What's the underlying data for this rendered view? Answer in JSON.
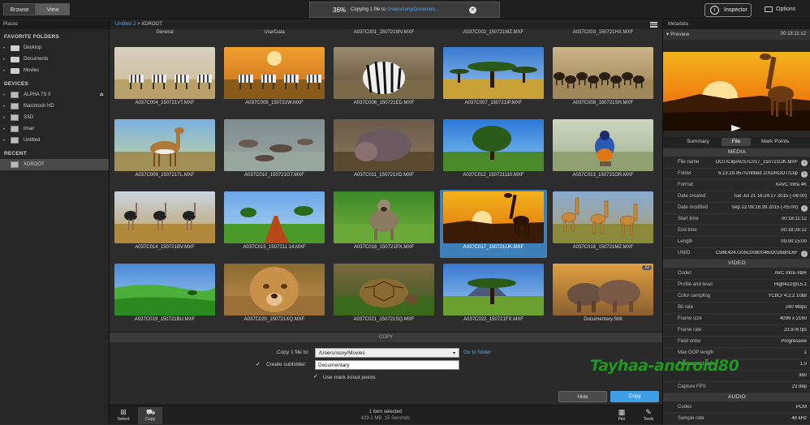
{
  "topbar": {
    "browse_label": "Browse",
    "view_label": "View",
    "progress_pct": "36%",
    "progress_msg": "Copying 1 file to",
    "progress_path": "/Users/sony/Documen...",
    "inspector_label": "Inspector",
    "options_label": "Options"
  },
  "places": {
    "header": "Places",
    "favorites_title": "FAVORITE FOLDERS",
    "favorites": [
      "Desktop",
      "Documents",
      "Movies"
    ],
    "devices_title": "DEVICES",
    "devices": [
      "ALPHA 7S II",
      "Macintosh HD",
      "SSD",
      "tmair",
      "Untitled"
    ],
    "recent_title": "RECENT",
    "recent": [
      "XDROOT"
    ]
  },
  "breadcrumb": {
    "parent": "Untitled 2",
    "sep": ">",
    "current": "XDROOT"
  },
  "grid": {
    "top_labels": [
      "General",
      "UserData",
      "A037C001_150721MV.MXF",
      "A037C002_150721MZ.MXF",
      "A037C003_150721HX.MXF"
    ],
    "items": [
      {
        "name": "A037C004_150721VT.MXF",
        "scene": "zebras"
      },
      {
        "name": "A037C005_150721W.MXF",
        "scene": "sunset-zebras"
      },
      {
        "name": "A037C006_150721ED.MXF",
        "scene": "zebra-close"
      },
      {
        "name": "A037C007_150721IP.MXF",
        "scene": "acacia"
      },
      {
        "name": "A037C008_150721SH.MXF",
        "scene": "wildebeest"
      },
      {
        "name": "A037C009_150721TL.MXF",
        "scene": "gazelle"
      },
      {
        "name": "A037C010_150721GT.MXF",
        "scene": "hippos-water"
      },
      {
        "name": "A037C011_150721XD.MXF",
        "scene": "hippo"
      },
      {
        "name": "A037C012_150721110.MXF",
        "scene": "baobab"
      },
      {
        "name": "A037C013_150721OR.MXF",
        "scene": "bird"
      },
      {
        "name": "A037C014_150721BV.MXF",
        "scene": "ostriches"
      },
      {
        "name": "A037C015_1507211 14.MXF",
        "scene": "red-path"
      },
      {
        "name": "A037C016_150721PX.MXF",
        "scene": "baboon"
      },
      {
        "name": "A037C017_150721IJK.MXF",
        "scene": "giraffe-sunset",
        "selected": true
      },
      {
        "name": "A037C018_150721MZ.MXF",
        "scene": "giraffes"
      },
      {
        "name": "A037C019_150721BU.MXF",
        "scene": "green-valley"
      },
      {
        "name": "A037C020_150721XQ.MXF",
        "scene": "lioness"
      },
      {
        "name": "A037C021_150721SQ.MXF",
        "scene": "tortoise"
      },
      {
        "name": "A037C022_150721FX.MXF",
        "scene": "mountain"
      },
      {
        "name": "Documentary.SMI",
        "scene": "elephants",
        "badge": "22"
      }
    ]
  },
  "copy_panel": {
    "title": "COPY",
    "copy_to_label": "Copy 1 file to:",
    "destination": "/Users/sony/Movies",
    "goto_label": "Go to folder",
    "subfolder_label": "Create subfolder:",
    "subfolder_value": "Documentary",
    "markinout_label": "Use mark in/out points",
    "hide_label": "Hide",
    "copy_label": "Copy"
  },
  "bottom": {
    "select_label": "Select",
    "copy_label": "Copy",
    "status_line1": "1 item selected",
    "status_line2": "429.1 MB, 15 Seconds",
    "file_label": "File",
    "tools_label": "Tools"
  },
  "metadata": {
    "header": "Metadata",
    "preview_label": "Preview",
    "preview_tc": "00:18:11:12",
    "tabs": [
      "Summary",
      "File",
      "Mark Points"
    ],
    "sections": [
      {
        "title": "MEDIA",
        "rows": [
          {
            "k": "File name",
            "v": "OOT/Clip/A037C017_150721IJK.MXF",
            "info": true
          },
          {
            "k": "Folder",
            "v": "6.13.19.957/Untitled 2/XDROOT/Clip",
            "info": true
          },
          {
            "k": "Format",
            "v": "XAVC Intra 4K",
            "info": false
          },
          {
            "k": "Date created",
            "v": "Tue Jul 21 16:24:27 2015 (-06:00)",
            "info": false
          },
          {
            "k": "Date modified",
            "v": "Sep 22 09:16:39 2015 (-05:00)",
            "info": true
          },
          {
            "k": "Start time",
            "v": "00:18:11:12",
            "info": false
          },
          {
            "k": "End time",
            "v": "00:18:26:12",
            "info": false
          },
          {
            "k": "Length",
            "v": "00:00:15:00",
            "info": false
          },
          {
            "k": "UMID",
            "v": "C58E4247205C008004602026B0C6F",
            "info": true
          }
        ]
      },
      {
        "title": "VIDEO",
        "rows": [
          {
            "k": "Codec",
            "v": "AVC Intra VBR",
            "info": false
          },
          {
            "k": "Profile and level",
            "v": "High422@L5.1",
            "info": false
          },
          {
            "k": "Color sampling",
            "v": "YCbCr 4:2:2 10bit",
            "info": false
          },
          {
            "k": "Bit rate",
            "v": "240 Mbps",
            "info": false
          },
          {
            "k": "Frame size",
            "v": "4096 x 2160",
            "info": false
          },
          {
            "k": "Frame rate",
            "v": "23.976 fps",
            "info": false
          },
          {
            "k": "Field order",
            "v": "Progressive",
            "info": false
          },
          {
            "k": "Max GOP length",
            "v": "1",
            "info": false
          },
          {
            "k": "Pixel aspect ratio",
            "v": "1.0",
            "info": false
          },
          {
            "k": "",
            "v": "360",
            "info": false
          },
          {
            "k": "Capture FPS",
            "v": "23.98p",
            "info": false
          }
        ]
      },
      {
        "title": "AUDIO",
        "rows": [
          {
            "k": "Codec",
            "v": "PCM",
            "info": false
          },
          {
            "k": "Sample rate",
            "v": "48 kHz",
            "info": false
          }
        ]
      }
    ]
  },
  "watermark": "Tayhaa-android80",
  "colors": {
    "accent": "#3f9fe6",
    "link": "#58a6e8",
    "selection": "#3d7fb8"
  }
}
